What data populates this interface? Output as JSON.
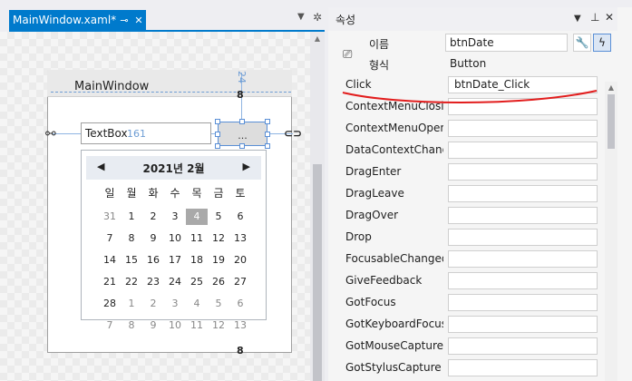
{
  "designer": {
    "tab_title": "MainWindow.xaml*",
    "tab_pin_icon": "pin-icon",
    "tab_close_icon": "close-icon",
    "window_title": "MainWindow",
    "margin_top_value": "24",
    "margin_left_value": "161",
    "textbox_text": "TextBox",
    "button_text": "...",
    "calendar": {
      "title": "2021년 2월",
      "weekdays": [
        "일",
        "월",
        "화",
        "수",
        "목",
        "금",
        "토"
      ],
      "weeks": [
        [
          "31",
          "1",
          "2",
          "3",
          "4",
          "5",
          "6"
        ],
        [
          "7",
          "8",
          "9",
          "10",
          "11",
          "12",
          "13"
        ],
        [
          "14",
          "15",
          "16",
          "17",
          "18",
          "19",
          "20"
        ],
        [
          "21",
          "22",
          "23",
          "24",
          "25",
          "26",
          "27"
        ],
        [
          "28",
          "1",
          "2",
          "3",
          "4",
          "5",
          "6"
        ],
        [
          "7",
          "8",
          "9",
          "10",
          "11",
          "12",
          "13"
        ]
      ],
      "selected_day": "4"
    }
  },
  "properties": {
    "title": "속성",
    "name_label": "이름",
    "name_value": "btnDate",
    "type_label": "형식",
    "type_value": "Button",
    "events": [
      {
        "name": "Click",
        "handler": "btnDate_Click"
      },
      {
        "name": "ContextMenuClosing",
        "handler": ""
      },
      {
        "name": "ContextMenuOpening",
        "handler": ""
      },
      {
        "name": "DataContextChanged",
        "handler": ""
      },
      {
        "name": "DragEnter",
        "handler": ""
      },
      {
        "name": "DragLeave",
        "handler": ""
      },
      {
        "name": "DragOver",
        "handler": ""
      },
      {
        "name": "Drop",
        "handler": ""
      },
      {
        "name": "FocusableChanged",
        "handler": ""
      },
      {
        "name": "GiveFeedback",
        "handler": ""
      },
      {
        "name": "GotFocus",
        "handler": ""
      },
      {
        "name": "GotKeyboardFocus",
        "handler": ""
      },
      {
        "name": "GotMouseCapture",
        "handler": ""
      },
      {
        "name": "GotStylusCapture",
        "handler": ""
      }
    ]
  },
  "colors": {
    "accent": "#007acc",
    "selection": "#5a8fd6",
    "annotation_red": "#e21d1d"
  }
}
